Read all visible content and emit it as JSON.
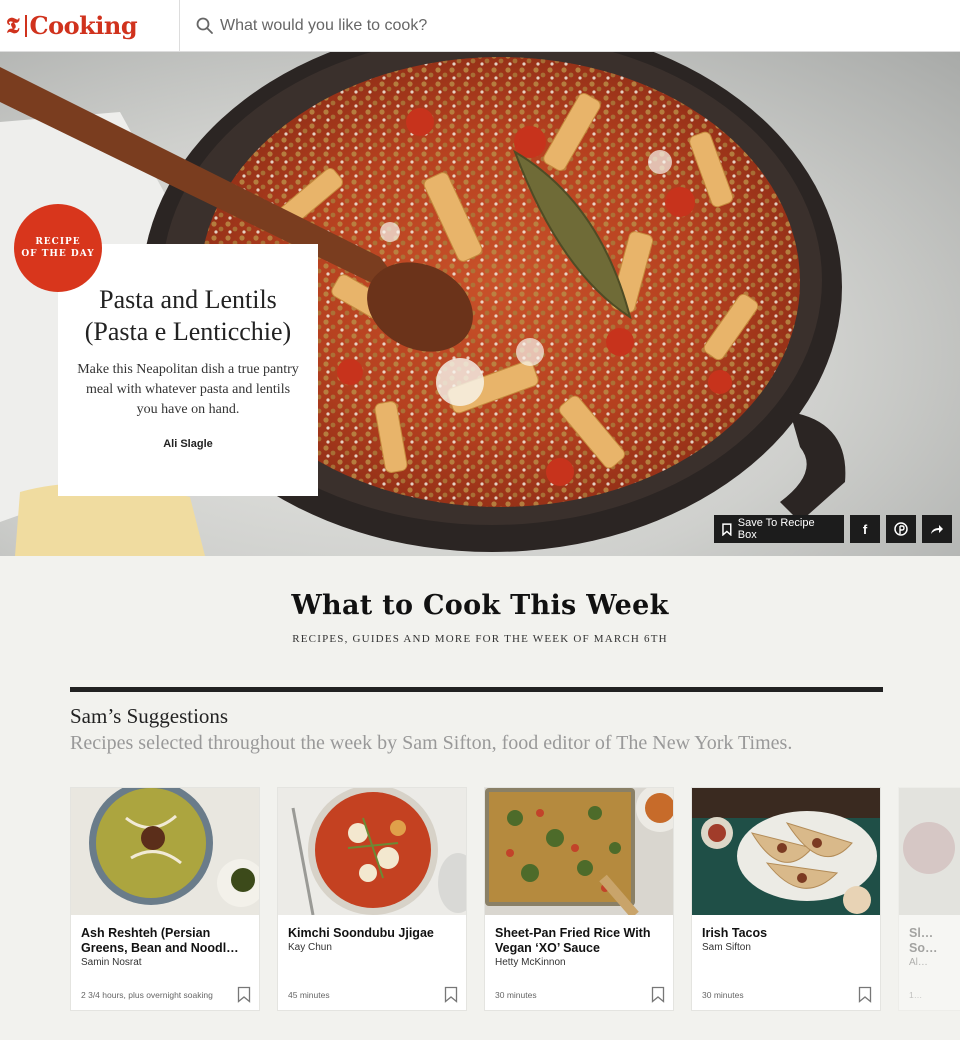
{
  "header": {
    "logo_mark": "𝕿",
    "logo_text": "Cooking",
    "search_placeholder": "What would you like to cook?"
  },
  "hero": {
    "badge_line1": "RECIPE",
    "badge_line2": "OF THE DAY",
    "title": "Pasta and Lentils (Pasta e Lenticchie)",
    "description": "Make this Neapolitan dish a true pantry meal with whatever pasta and lentils you have on hand.",
    "author": "Ali Slagle",
    "actions": {
      "save_label": "Save To Recipe Box",
      "facebook": "f",
      "pinterest": "P",
      "share": "share-icon"
    }
  },
  "section": {
    "title": "What to Cook This Week",
    "subtitle": "RECIPES, GUIDES AND MORE FOR THE WEEK OF MARCH 6TH",
    "list_title": "Sam’s Suggestions",
    "list_description": "Recipes selected throughout the week by Sam Sifton, food editor of The New York Times."
  },
  "recipes": [
    {
      "title": "Ash Reshteh (Persian Greens, Bean and Noodl…",
      "author": "Samin Nosrat",
      "time": "2 3/4 hours, plus overnight soaking"
    },
    {
      "title": "Kimchi Soondubu Jjigae",
      "author": "Kay Chun",
      "time": "45 minutes"
    },
    {
      "title": "Sheet-Pan Fried Rice With Vegan ‘XO’ Sauce",
      "author": "Hetty McKinnon",
      "time": "30 minutes"
    },
    {
      "title": "Irish Tacos",
      "author": "Sam Sifton",
      "time": "30 minutes"
    },
    {
      "title": "Sl… So…",
      "author": "Al…",
      "time": "1…"
    }
  ],
  "colors": {
    "brand_red": "#d0321d",
    "badge_red": "#d8361c",
    "dark_button": "#1c1c1c"
  }
}
